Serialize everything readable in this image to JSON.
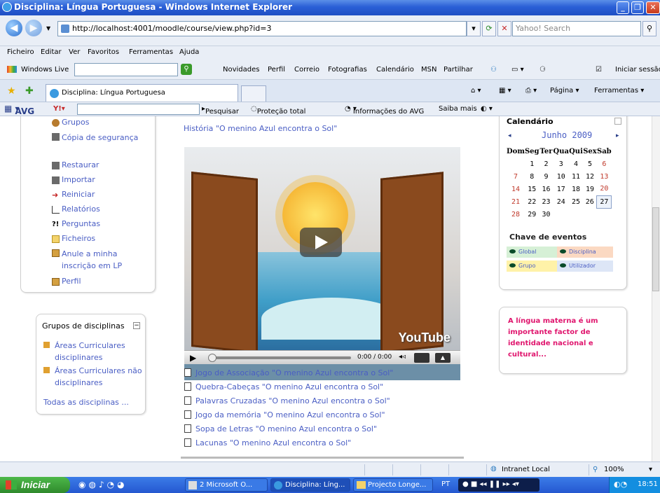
{
  "window": {
    "title": "Disciplina: Língua Portuguesa - Windows Internet Explorer"
  },
  "addressbar": {
    "url": "http://localhost:4001/moodle/course/view.php?id=3",
    "search_placeholder": "Yahoo! Search"
  },
  "menubar": [
    "Ficheiro",
    "Editar",
    "Ver",
    "Favoritos",
    "Ferramentas",
    "Ajuda"
  ],
  "livebar": {
    "brand": "Windows Live",
    "links": [
      "Novidades",
      "Perfil",
      "Correio",
      "Fotografias",
      "Calendário",
      "MSN",
      "Partilhar"
    ],
    "signin": "Iniciar sessão"
  },
  "tabs": {
    "active": "Disciplina: Língua Portuguesa",
    "right_tools": [
      "Página",
      "Ferramentas"
    ]
  },
  "avgbar": {
    "brand": "AVG",
    "items": [
      "Pesquisar",
      "Proteção total",
      "Informações do AVG",
      "Saiba mais"
    ]
  },
  "admin_menu": [
    "Grupos",
    "Cópia de segurança",
    "Restaurar",
    "Importar",
    "Reiniciar",
    "Relatórios",
    "Perguntas",
    "Ficheiros",
    "Anule a minha inscrição em LP",
    "Perfil"
  ],
  "course_groups": {
    "title": "Grupos de disciplinas",
    "items": [
      "Áreas Curriculares disciplinares",
      "Áreas Curriculares não disciplinares"
    ],
    "all": "Todas as disciplinas ..."
  },
  "main": {
    "story_link": "História \"O menino Azul encontra o Sol\"",
    "video": {
      "brand": "YouTube",
      "time": "0:00 / 0:00",
      "progress": 0
    },
    "resources": [
      "Jogo de Associação \"O menino Azul encontra o Sol\"",
      "Quebra-Cabeças \"O menino Azul encontra o Sol\"",
      "Palavras Cruzadas \"O menino Azul encontra o Sol\"",
      "Jogo da memória \"O menino Azul encontra o Sol\"",
      "Sopa de Letras \"O menino Azul encontra o Sol\"",
      "Lacunas \"O menino Azul encontra o Sol\""
    ]
  },
  "calendar": {
    "title": "Calendário",
    "month": "Junho 2009",
    "weekdays": [
      "Dom",
      "Seg",
      "Ter",
      "Qua",
      "Qui",
      "Sex",
      "Sab"
    ],
    "weeks": [
      [
        "",
        "1",
        "2",
        "3",
        "4",
        "5",
        "6"
      ],
      [
        "7",
        "8",
        "9",
        "10",
        "11",
        "12",
        "13"
      ],
      [
        "14",
        "15",
        "16",
        "17",
        "18",
        "19",
        "20"
      ],
      [
        "21",
        "22",
        "23",
        "24",
        "25",
        "26",
        "27"
      ],
      [
        "28",
        "29",
        "30",
        "",
        "",
        "",
        ""
      ]
    ],
    "today": "27",
    "events_title": "Chave de eventos",
    "events": [
      "Global",
      "Disciplina",
      "Grupo",
      "Utilizador"
    ]
  },
  "quote": "A língua materna é um importante factor de identidade nacional e cultural...",
  "statusbar": {
    "zone": "Intranet Local",
    "zoom": "100%"
  },
  "taskbar": {
    "start": "Iniciar",
    "tasks": [
      "2 Microsoft O...",
      "Disciplina: Líng...",
      "Projecto Longe..."
    ],
    "lang": "PT",
    "clock": "18:51"
  },
  "colors": {
    "link": "#4a5ec4",
    "quote": "#e0166e",
    "holiday": "#c0392b",
    "titlebar": "#2a5fd6"
  }
}
